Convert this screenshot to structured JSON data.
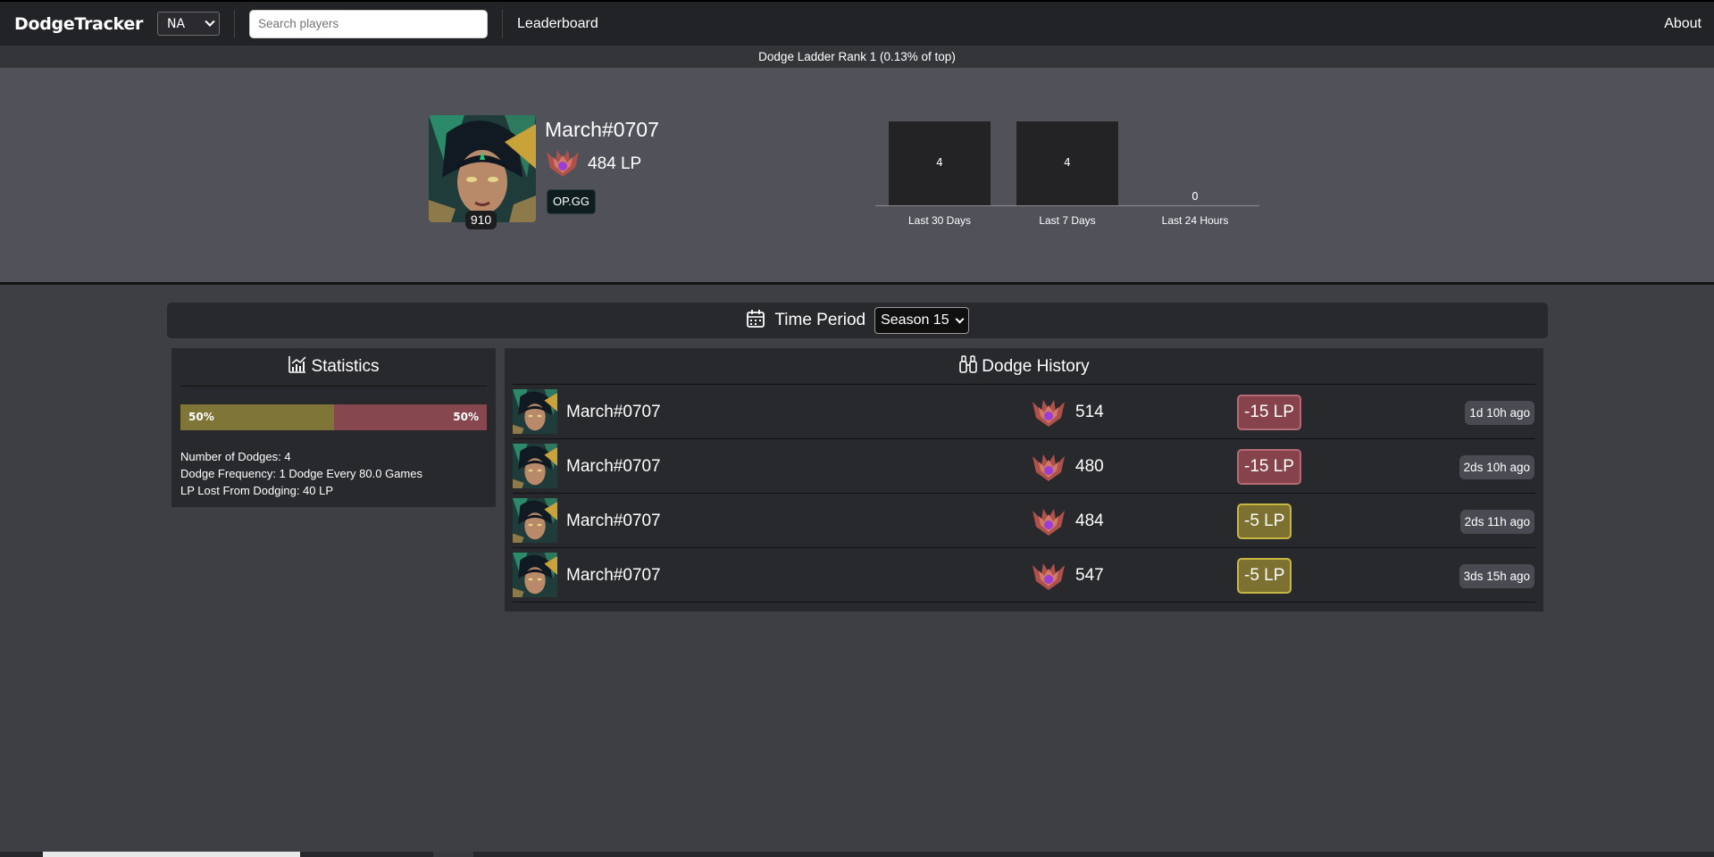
{
  "navbar": {
    "brand": "DodgeTracker",
    "region": "NA",
    "search_placeholder": "Search players",
    "leaderboard": "Leaderboard",
    "about": "About"
  },
  "rank_banner": "Dodge Ladder Rank 1 (0.13% of top)",
  "profile": {
    "name": "March#0707",
    "lp": "484 LP",
    "level": "910",
    "opgg": "OP.GG",
    "rank_icon": "master-emblem-icon"
  },
  "dodge_chart": {
    "type": "bar",
    "categories": [
      "Last 30 Days",
      "Last 7 Days",
      "Last 24 Hours"
    ],
    "values": [
      4,
      4,
      0
    ],
    "value_labels": [
      "4",
      "4",
      "0"
    ]
  },
  "time_period": {
    "label": "Time Period",
    "selected": "Season 15"
  },
  "statistics": {
    "title": "Statistics",
    "ratio_left": "50%",
    "ratio_right": "50%",
    "ratio_left_fraction": 0.5,
    "lines": [
      "Number of Dodges: 4",
      "Dodge Frequency: 1 Dodge Every 80.0 Games",
      "LP Lost From Dodging: 40 LP"
    ]
  },
  "history": {
    "title": "Dodge History",
    "rows": [
      {
        "name": "March#0707",
        "lp": "514",
        "loss": "-15 LP",
        "kind": "big",
        "when": "1d 10h ago"
      },
      {
        "name": "March#0707",
        "lp": "480",
        "loss": "-15 LP",
        "kind": "big",
        "when": "2ds 10h ago"
      },
      {
        "name": "March#0707",
        "lp": "484",
        "loss": "-5 LP",
        "kind": "small",
        "when": "2ds 11h ago"
      },
      {
        "name": "March#0707",
        "lp": "547",
        "loss": "-5 LP",
        "kind": "small",
        "when": "3ds 15h ago"
      }
    ]
  },
  "colors": {
    "navbar": "#222326",
    "profile_bg": "#505159",
    "page_bg": "#3e3f44",
    "panel_bg": "#28292c",
    "big_loss": "#86434b",
    "small_loss": "#7c7130"
  }
}
